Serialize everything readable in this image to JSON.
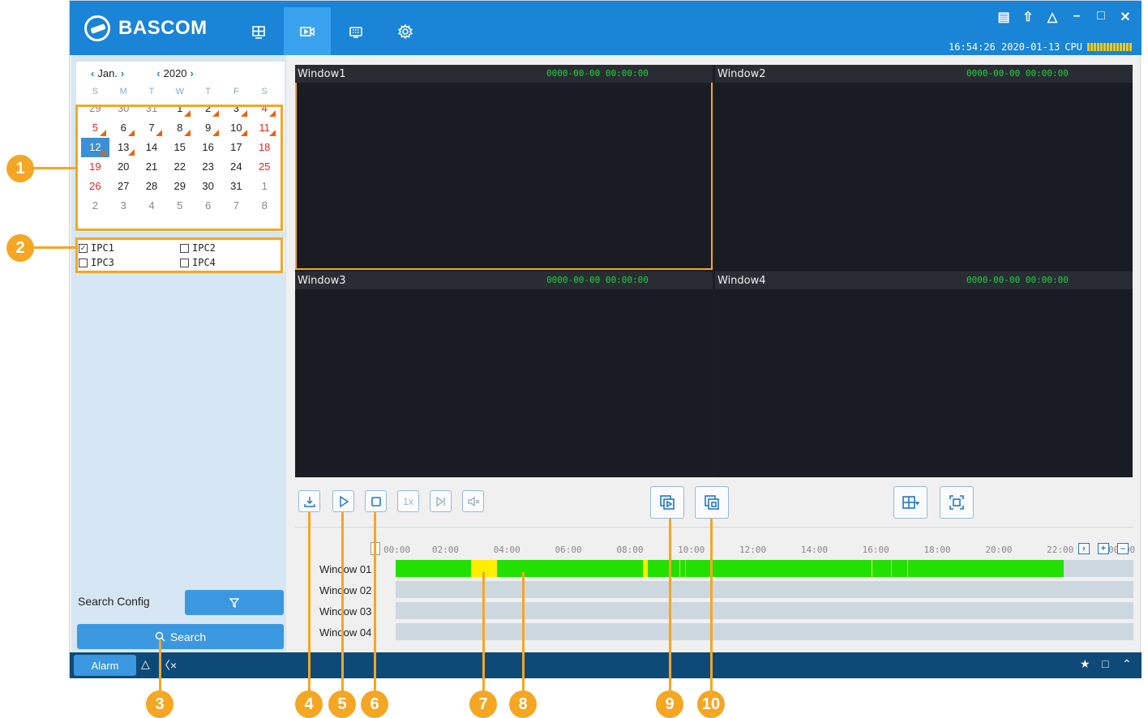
{
  "app": {
    "brand": "BASCOM",
    "status_time": "16:54:26 2020-01-13",
    "cpu_label": "CPU",
    "nav": [
      "live-view",
      "playback",
      "events",
      "settings"
    ],
    "window_controls": [
      "screen-icon",
      "upload-icon",
      "user-icon",
      "minimize-icon",
      "maximize-icon",
      "close-icon"
    ]
  },
  "calendar": {
    "month": "Jan.",
    "year": "2020",
    "weekdays": [
      "S",
      "M",
      "T",
      "W",
      "T",
      "F",
      "S"
    ],
    "days": [
      {
        "d": "29",
        "muted": true
      },
      {
        "d": "30",
        "muted": true
      },
      {
        "d": "31",
        "muted": true
      },
      {
        "d": "1",
        "rec": true
      },
      {
        "d": "2",
        "rec": true
      },
      {
        "d": "3",
        "rec": true
      },
      {
        "d": "4",
        "weekend": true,
        "rec": true
      },
      {
        "d": "5",
        "weekend": true,
        "rec": true
      },
      {
        "d": "6",
        "rec": true
      },
      {
        "d": "7",
        "rec": true
      },
      {
        "d": "8",
        "rec": true
      },
      {
        "d": "9",
        "rec": true
      },
      {
        "d": "10",
        "rec": true
      },
      {
        "d": "11",
        "weekend": true,
        "rec": true
      },
      {
        "d": "12",
        "weekend": true,
        "selected": true,
        "rec": true
      },
      {
        "d": "13",
        "rec": true
      },
      {
        "d": "14"
      },
      {
        "d": "15"
      },
      {
        "d": "16"
      },
      {
        "d": "17"
      },
      {
        "d": "18",
        "weekend": true
      },
      {
        "d": "19",
        "weekend": true
      },
      {
        "d": "20"
      },
      {
        "d": "21"
      },
      {
        "d": "22"
      },
      {
        "d": "23"
      },
      {
        "d": "24"
      },
      {
        "d": "25",
        "weekend": true
      },
      {
        "d": "26",
        "weekend": true
      },
      {
        "d": "27"
      },
      {
        "d": "28"
      },
      {
        "d": "29"
      },
      {
        "d": "30"
      },
      {
        "d": "31"
      },
      {
        "d": "1",
        "muted": true
      },
      {
        "d": "2",
        "muted": true
      },
      {
        "d": "3",
        "muted": true
      },
      {
        "d": "4",
        "muted": true
      },
      {
        "d": "5",
        "muted": true
      },
      {
        "d": "6",
        "muted": true
      },
      {
        "d": "7",
        "muted": true
      },
      {
        "d": "8",
        "muted": true
      }
    ]
  },
  "channels": [
    {
      "label": "IPC1",
      "checked": true
    },
    {
      "label": "IPC2",
      "checked": false
    },
    {
      "label": "IPC3",
      "checked": false
    },
    {
      "label": "IPC4",
      "checked": false
    }
  ],
  "search": {
    "config_label": "Search Config",
    "search_label": "Search"
  },
  "windows": [
    {
      "name": "Window1",
      "time": "0000-00-00 00:00:00"
    },
    {
      "name": "Window2",
      "time": "0000-00-00 00:00:00"
    },
    {
      "name": "Window3",
      "time": "0000-00-00 00:00:00"
    },
    {
      "name": "Window4",
      "time": "0000-00-00 00:00:00"
    }
  ],
  "controls": {
    "speed": "1x"
  },
  "timeline": {
    "hours": [
      "00:00",
      "02:00",
      "04:00",
      "06:00",
      "08:00",
      "10:00",
      "12:00",
      "14:00",
      "16:00",
      "18:00",
      "20:00",
      "22:00",
      "00:00"
    ],
    "rows": [
      "Window 01",
      "Window 02",
      "Window 03",
      "Window 04"
    ],
    "segments_window01": [
      {
        "start_hour": 0.0,
        "end_hour": 2.7,
        "color": "#22e000"
      },
      {
        "start_hour": 2.7,
        "end_hour": 3.65,
        "color": "#ffee00"
      },
      {
        "start_hour": 3.65,
        "end_hour": 8.9,
        "color": "#22e000"
      },
      {
        "start_hour": 8.9,
        "end_hour": 9.05,
        "color": "#ffee00"
      },
      {
        "start_hour": 9.05,
        "end_hour": 24.0,
        "color": "#22e000"
      }
    ],
    "recording_end_hour": 24.0
  },
  "bottom": {
    "alarm_label": "Alarm"
  },
  "callouts": [
    "1",
    "2",
    "3",
    "4",
    "5",
    "6",
    "7",
    "8",
    "9",
    "10"
  ],
  "colors": {
    "header": "#1a84d6",
    "accent": "#3b98e0",
    "highlight": "#f5a623",
    "record_green": "#22e000",
    "event_yellow": "#ffee00"
  }
}
